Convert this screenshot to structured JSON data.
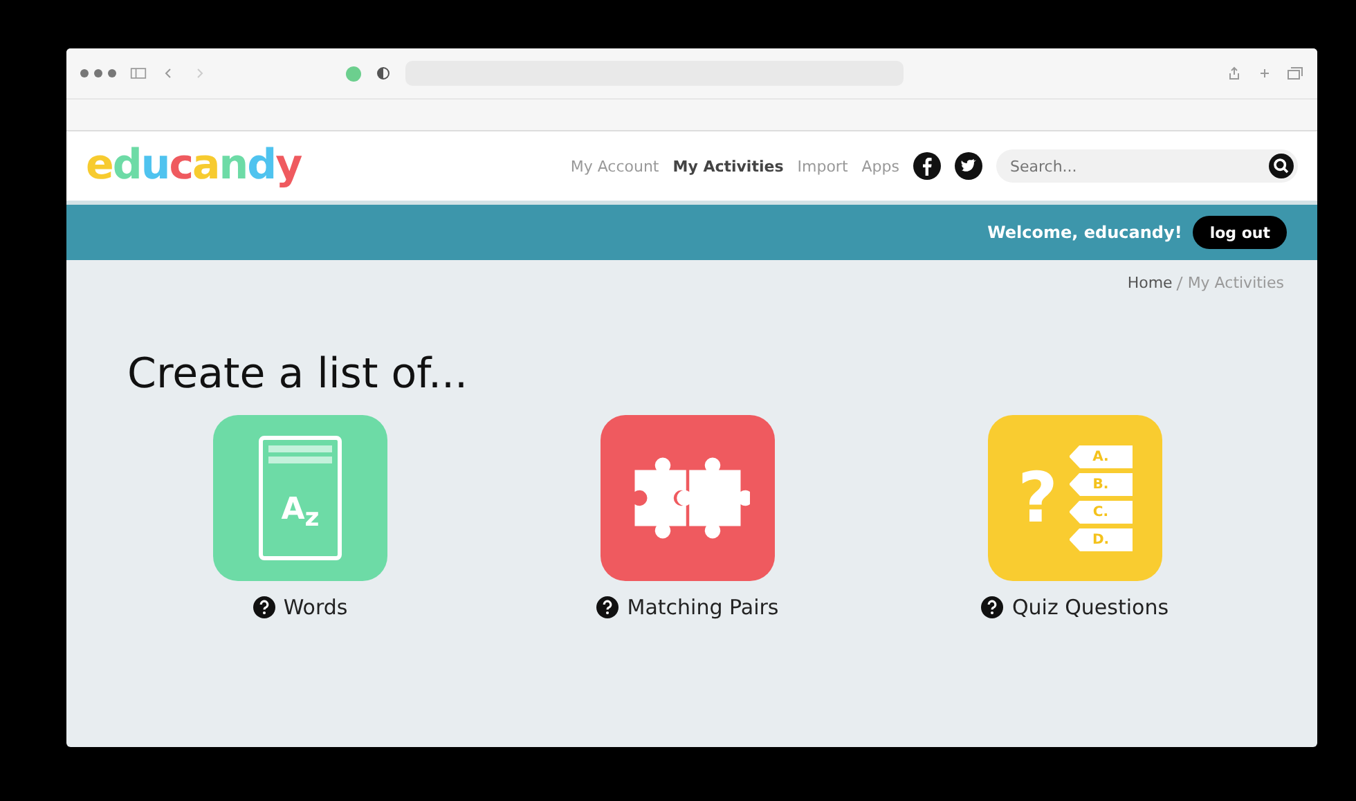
{
  "logo": {
    "letters": [
      {
        "char": "e",
        "color": "#f7cb2f"
      },
      {
        "char": "d",
        "color": "#6ddba6"
      },
      {
        "char": "u",
        "color": "#4fc3ef"
      },
      {
        "char": "c",
        "color": "#ef5a5f"
      },
      {
        "char": "a",
        "color": "#f7cb2f"
      },
      {
        "char": "n",
        "color": "#6ddba6"
      },
      {
        "char": "d",
        "color": "#4fc3ef"
      },
      {
        "char": "y",
        "color": "#ef5a5f"
      }
    ]
  },
  "nav": [
    {
      "label": "My Account",
      "selected": false
    },
    {
      "label": "My Activities",
      "selected": true
    },
    {
      "label": "Import",
      "selected": false
    },
    {
      "label": "Apps",
      "selected": false
    }
  ],
  "search": {
    "placeholder": "Search..."
  },
  "welcome": "Welcome, educandy!",
  "logout": "log out",
  "breadcrumb": [
    {
      "label": "Home"
    },
    {
      "label": "My Activities"
    }
  ],
  "heading": "Create a list of...",
  "activities": [
    {
      "kind": "words",
      "label": "Words",
      "color": "#6ddba6",
      "marks": [
        "A",
        "z"
      ]
    },
    {
      "kind": "pairs",
      "label": "Matching Pairs",
      "color": "#ef5a5f"
    },
    {
      "kind": "quiz",
      "label": "Quiz Questions",
      "color": "#f9cc30",
      "marks": [
        "?",
        "A.",
        "B.",
        "C.",
        "D."
      ]
    }
  ]
}
